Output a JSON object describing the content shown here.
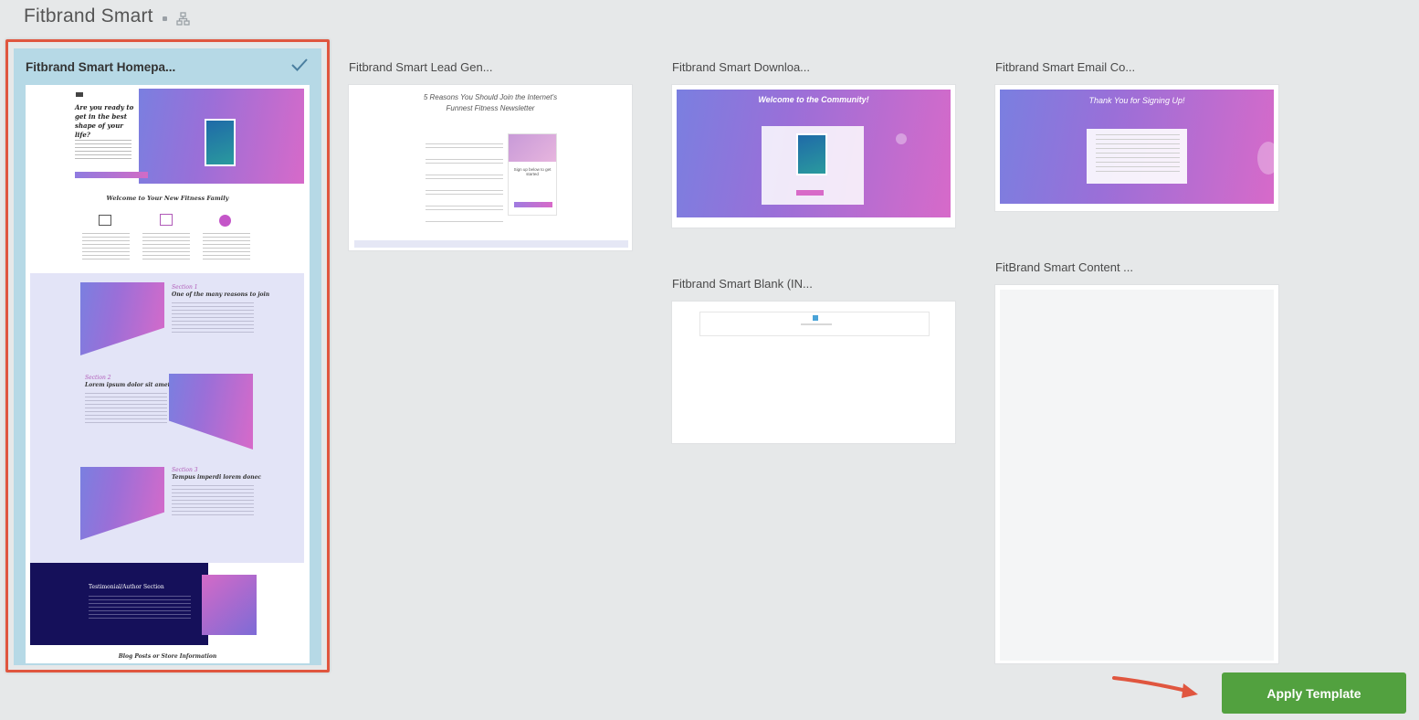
{
  "header": {
    "title": "Fitbrand Smart"
  },
  "templates": [
    {
      "label": "Fitbrand Smart Homepa...",
      "selected": true
    },
    {
      "label": "Fitbrand Smart Lead Gen..."
    },
    {
      "label": "Fitbrand Smart Downloa..."
    },
    {
      "label": "Fitbrand Smart Email Co..."
    },
    {
      "label": "Fitbrand Smart Blank (IN..."
    },
    {
      "label": "FitBrand Smart Content ..."
    }
  ],
  "previews": {
    "home": {
      "hero_heading": "Are you ready to get in the best shape of your life?",
      "welcome": "Welcome to Your New Fitness Family",
      "s1_title": "Section 1",
      "s1_heading": "One of the many reasons to join",
      "s2_title": "Section 2",
      "s2_heading": "Lorem ipsum dolor sit amet",
      "s3_title": "Section 3",
      "s3_heading": "Tempus imperdi lorem donec",
      "testimonial": "Testimonial/Author Section",
      "blog": "Blog Posts or Store Information"
    },
    "leadgen": {
      "heading": "5 Reasons You Should Join the Internet's Funnest Fitness Newsletter",
      "cta": "Sign up below to get started"
    },
    "download": {
      "heading": "Welcome to the Community!"
    },
    "email": {
      "heading": "Thank You for Signing Up!"
    }
  },
  "apply_button": {
    "label": "Apply Template"
  },
  "colors": {
    "accent": "#52a13f",
    "selection": "#e0563f",
    "selected_bg": "#b6d9e6"
  }
}
